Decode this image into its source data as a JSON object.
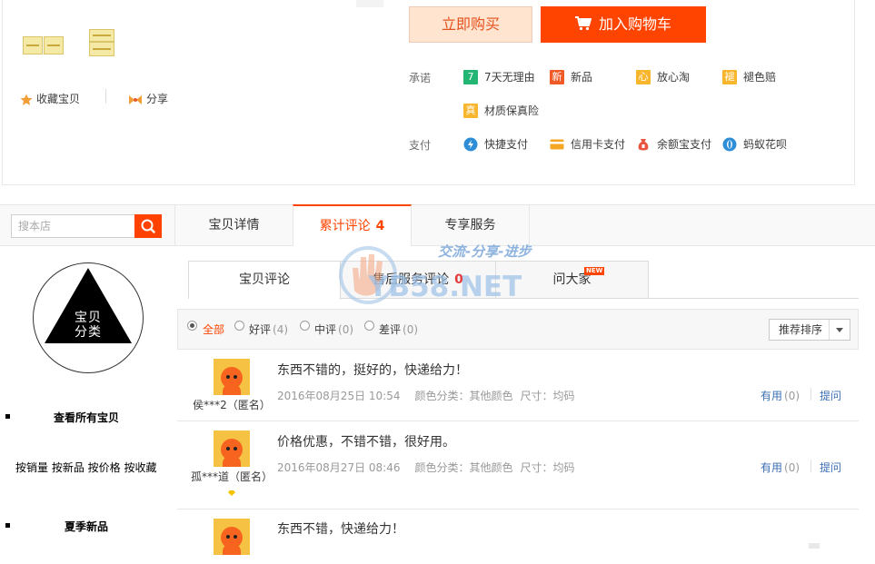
{
  "product": {
    "favorite_label": "收藏宝贝",
    "share_label": "分享",
    "buy_now_label": "立即购买",
    "add_cart_label": "加入购物车",
    "promise_label": "承诺",
    "pay_label": "支付",
    "promises": [
      {
        "label": "7天无理由",
        "icon": "seven-days-icon",
        "glyph": "7",
        "color": "#22b573"
      },
      {
        "label": "新品",
        "icon": "new-product-icon",
        "glyph": "新",
        "color": "#f05a28"
      },
      {
        "label": "放心淘",
        "icon": "trust-icon",
        "glyph": "心",
        "color": "#f8b62d"
      },
      {
        "label": "褪色赔",
        "icon": "fade-compensation-icon",
        "glyph": "褪",
        "color": "#f8b62d"
      },
      {
        "label": "材质保真险",
        "icon": "material-insurance-icon",
        "glyph": "真",
        "color": "#f8b62d"
      }
    ],
    "payments": [
      {
        "label": "快捷支付",
        "icon": "quick-pay-icon",
        "color": "#2d8ed7"
      },
      {
        "label": "信用卡支付",
        "icon": "credit-card-icon",
        "color": "#f5a623"
      },
      {
        "label": "余额宝支付",
        "icon": "yuebao-icon",
        "color": "#e8553f"
      },
      {
        "label": "蚂蚁花呗",
        "icon": "huabei-icon",
        "color": "#2d8ed7"
      }
    ]
  },
  "tabbar": {
    "search_placeholder": "搜本店",
    "tabs": [
      {
        "label": "宝贝详情"
      },
      {
        "label": "累计评论",
        "count": "4"
      },
      {
        "label": "专享服务"
      }
    ]
  },
  "sidebar": {
    "category_title": "宝贝分类",
    "view_all": "查看所有宝贝",
    "sort_links": "按销量 按新品 按价格 按收藏",
    "summer_new": "夏季新品"
  },
  "subtabs": {
    "reviews": "宝贝评论",
    "after_sale": "售后服务评论",
    "after_sale_count": "0",
    "ask_all": "问大家",
    "new_badge": "NEW"
  },
  "filters": {
    "items": [
      {
        "label": "全部",
        "count": ""
      },
      {
        "label": "好评",
        "count": "(4)"
      },
      {
        "label": "中评",
        "count": "(0)"
      },
      {
        "label": "差评",
        "count": "(0)"
      }
    ],
    "sort_label": "推荐排序"
  },
  "reviews": [
    {
      "nick": "侯***2（匿名）",
      "text": "东西不错的，挺好的，快递给力！",
      "date": "2016年08月25日 10:54",
      "color": "颜色分类：其他颜色",
      "size": "尺寸：均码",
      "useful": "有用",
      "useful_count": "(0)",
      "ask": "提问"
    },
    {
      "nick": "孤***道（匿名）",
      "text": "价格优惠，不错不错，很好用。",
      "date": "2016年08月27日 08:46",
      "color": "颜色分类：其他颜色",
      "size": "尺寸：均码",
      "useful": "有用",
      "useful_count": "(0)",
      "ask": "提问"
    },
    {
      "nick": "",
      "text": "东西不错，快递给力！",
      "date": "",
      "color": "",
      "size": "",
      "useful": "",
      "useful_count": "",
      "ask": ""
    }
  ],
  "watermark": {
    "slogan": "交流-分享-进步",
    "site": "YB58.NET"
  }
}
